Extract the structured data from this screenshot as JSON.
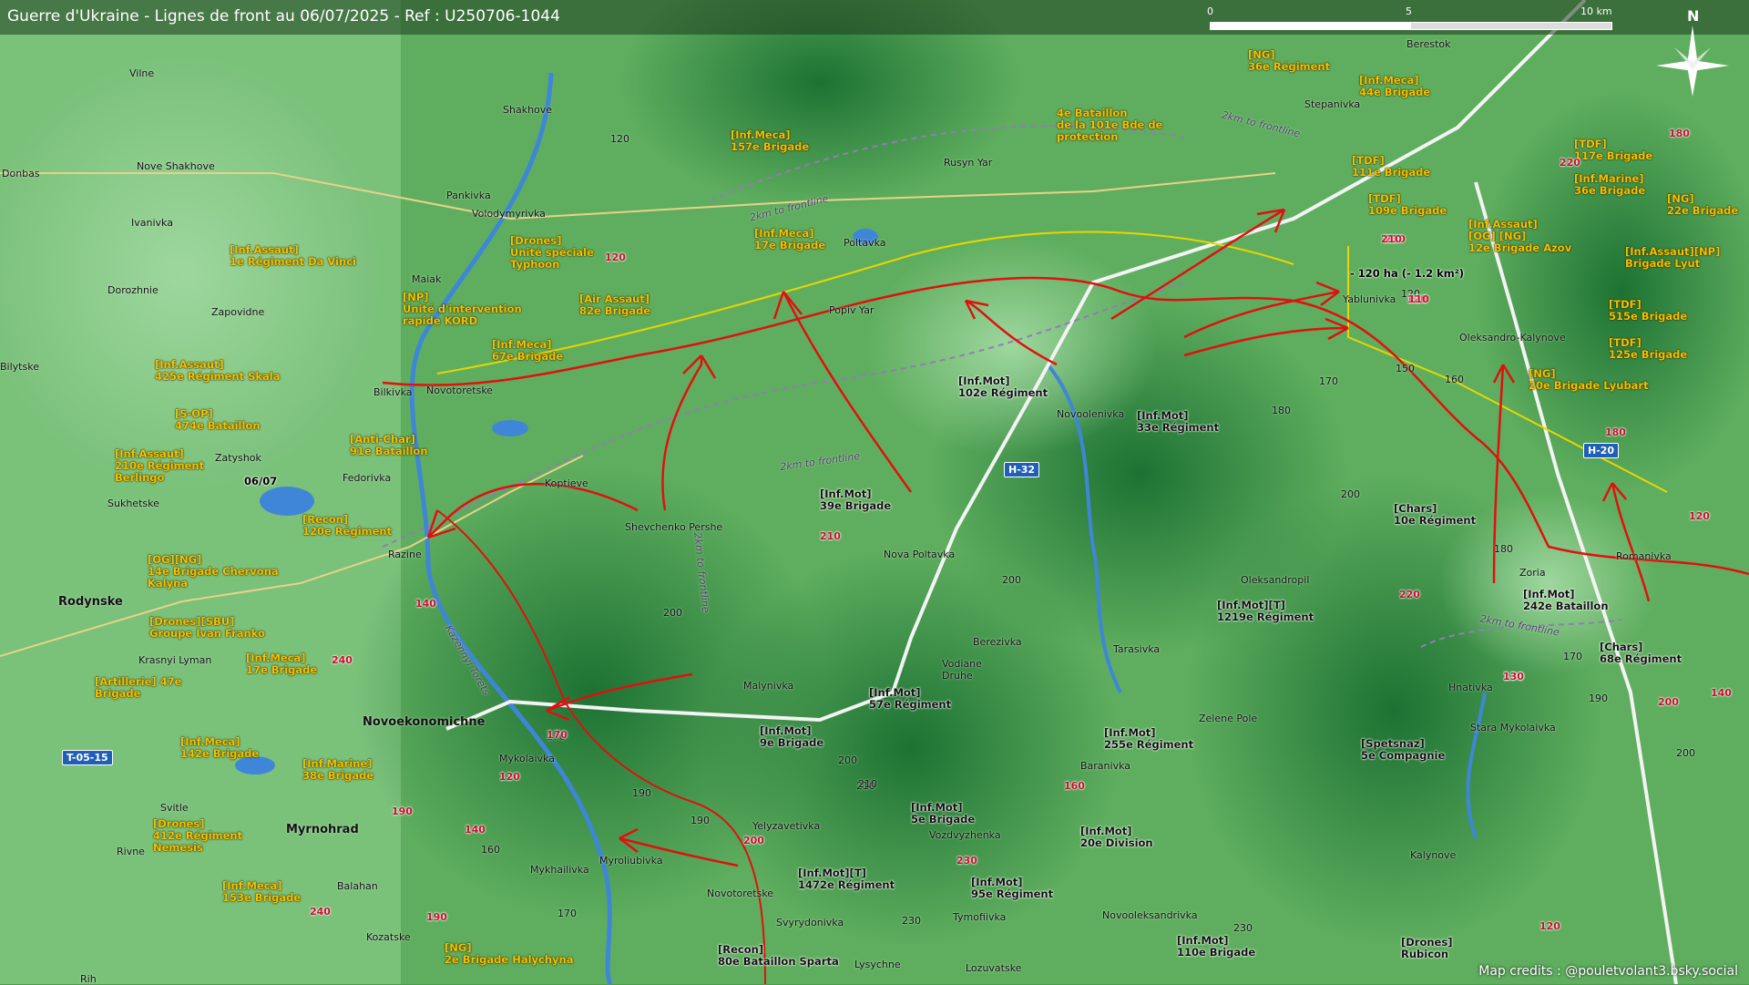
{
  "header": {
    "title": "Guerre d'Ukraine - Lignes de front au 06/07/2025 - Ref : U250706-1044",
    "scale_labels": [
      "0",
      "5",
      "10 km"
    ],
    "north_label": "N"
  },
  "credits": "Map credits : @pouletvolant3.bsky.social",
  "colors": {
    "terrain_light": "#7cc47c",
    "terrain_dark": "#1f7a35",
    "ukraine_unit": "#f2c200",
    "russian_unit": "#ff7a8a",
    "front_line": "#e01010",
    "highway_badge": "#1f5fb5"
  },
  "highways": [
    "H-32",
    "H-20",
    "T-05-15"
  ],
  "ukr_units": [
    "[NG]\n36e Régiment",
    "[Inf.Meca]\n44e Brigade",
    "[Inf.Meca]\n157e Brigade",
    "4e Bataillon\nde la 101e Bde de\nprotection",
    "[TDF]\n111e Brigade",
    "[TDF]\n117e Brigade",
    "[Inf.Marine]\n36e Brigade",
    "[NG]\n22e Brigade",
    "[TDF]\n109e Brigade",
    "[Inf.Assaut]\n[OG] [NG]\n12e Brigade Azov",
    "[Inf.Assaut][NP]\nBrigade Lyut",
    "[Inf.Meca]\n17e Brigade",
    "[Drones]\nUnité spéciale\nTyphoon",
    "[Inf.Assaut]\n1e Régiment Da Vinci",
    "[Air Assaut]\n82e Brigade",
    "[NP]\nUnité d'intervention\nrapide KORD",
    "[Inf.Meca]\n67e Brigade",
    "[Inf.Assaut]\n425e Régiment Skala",
    "[S-OP]\n474e Bataillon",
    "[Inf.Assaut]\n210e Régiment\nBerlingo",
    "[Anti-Char]\n91e Bataillon",
    "[Recon]\n120e Régiment",
    "[OG][NG]\n14e Brigade Chervona\nKalyna",
    "[Drones][SBU]\nGroupe Ivan Franko",
    "[Artillerie] 47e\nBrigade",
    "[Inf.Meca]\n17e Brigade",
    "[Inf.Meca]\n142e Brigade",
    "[Inf.Marine]\n38e Brigade",
    "[Drones]\n412e Régiment\nNemesis",
    "[Inf.Meca]\n153e Brigade",
    "[NG]\n2e Brigade Halychyna",
    "[TDF]\n515e Brigade",
    "[TDF]\n125e Brigade",
    "[NG]\n20e Brigade Lyubart"
  ],
  "rus_units": [
    "[Inf.Mot]\n102e Régiment",
    "[Inf.Mot]\n33e Régiment",
    "[Inf.Mot]\n39e Brigade",
    "[Chars]\n10e Régiment",
    "[Inf.Mot][T]\n1219e Régiment",
    "[Inf.Mot]\n242e Bataillon",
    "[Chars]\n68e Régiment",
    "[Inf.Mot]\n57e Régiment",
    "[Inf.Mot]\n9e Brigade",
    "[Inf.Mot]\n255e Régiment",
    "[Spetsnaz]\n5e Compagnie",
    "[Inf.Mot]\n5e Brigade",
    "[Inf.Mot]\n20e Division",
    "[Inf.Mot][T]\n1472e Régiment",
    "[Inf.Mot]\n95e Régiment",
    "[Inf.Mot]\n110e Brigade",
    "[Recon]\n80e Bataillon Sparta",
    "[Drones]\nRubicon"
  ],
  "cities": [
    "Rodynske",
    "Novoekonomichne",
    "Myrnohrad"
  ],
  "towns": [
    "Vilne",
    "Shakhove",
    "Berestok",
    "Stepanivka",
    "Donbas",
    "Nove Shakhove",
    "Rusyn Yar",
    "Pankivka",
    "Volodymyrivka",
    "Ivanivka",
    "Poltavka",
    "Dorozhnie",
    "Maiak",
    "Popiv Yar",
    "Yablunivka",
    "Oleksandro-Kalynove",
    "Zapovidne",
    "Novotoretske",
    "Bilytske",
    "Novoolenivka",
    "Bilkivka",
    "Zatyshok",
    "Fedorivka",
    "Sukhetske",
    "Koptieve",
    "Shevchenko Pershe",
    "Nova Poltavka",
    "Razine",
    "Romanivka",
    "Zoria",
    "Oleksandropil",
    "Krasnyi Lyman",
    "Berezivka",
    "Tarasivka",
    "Vodiane Druhe",
    "Malynivka",
    "Zelene Pole",
    "Hnativka",
    "Stara Mykolaivka",
    "Mykolaivka",
    "Baranivka",
    "Svitle",
    "Yelyzavetivka",
    "Vozdvyzhenka",
    "Rivne",
    "Balahan",
    "Mykhailivka",
    "Myroliubivka",
    "Novotoretske",
    "Kalynove",
    "Tymofiivka",
    "Svyrydonivka",
    "Novooleksandrivka",
    "Kozatske",
    "Lysychne",
    "Lozuvatske",
    "Rih"
  ],
  "front_texts": [
    "2km to frontline",
    "2km to frontline",
    "2km to frontline",
    "2km to frontline",
    "2km to frontline",
    "Kazennyi Torets"
  ],
  "area_note": "- 120 ha (- 1.2 km²)",
  "date_marker": "06/07",
  "elevations": [
    "120",
    "120",
    "170",
    "150",
    "160",
    "180",
    "200",
    "200",
    "200",
    "210",
    "190",
    "190",
    "170",
    "170",
    "160",
    "180",
    "170",
    "190",
    "230",
    "230",
    "200",
    "210",
    "200"
  ],
  "roads": [
    "180",
    "220",
    "210",
    "210",
    "120",
    "120",
    "210",
    "220",
    "240",
    "190",
    "240",
    "200",
    "230",
    "180",
    "140",
    "130",
    "120",
    "110",
    "140",
    "200",
    "170",
    "140",
    "120",
    "130",
    "160",
    "190",
    "120"
  ]
}
